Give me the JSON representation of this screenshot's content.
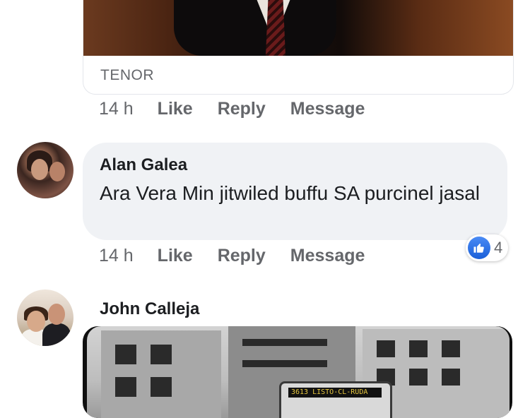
{
  "comments": [
    {
      "attachment": {
        "type": "gif",
        "source_label": "TENOR"
      },
      "time": "14 h",
      "actions": [
        "Like",
        "Reply",
        "Message"
      ]
    },
    {
      "author": "Alan Galea",
      "text": "Ara Vera Min jitwiled buffu SA purcinel jasal",
      "time": "14 h",
      "actions": [
        "Like",
        "Reply",
        "Message"
      ],
      "reactions": {
        "icon": "like-icon",
        "count": "4"
      }
    },
    {
      "author": "John Calleja",
      "attachment": {
        "type": "photo",
        "sign_text": "3613 LISTO-CL-RUDA"
      }
    }
  ],
  "colors": {
    "like_blue": "#1a5fd8",
    "bubble_bg": "#f0f2f5",
    "secondary_text": "#65676b"
  }
}
